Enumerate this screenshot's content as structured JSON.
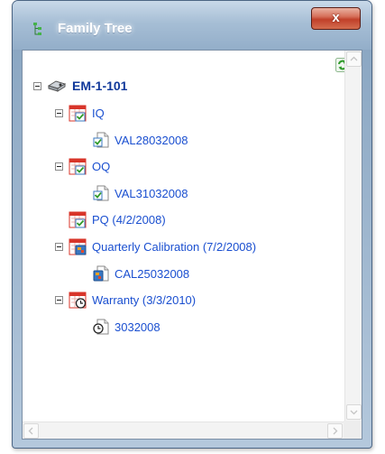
{
  "window": {
    "title": "Family Tree",
    "close_label": "x"
  },
  "tree": {
    "root": {
      "label": "EM-1-101",
      "icon": "equipment-icon"
    },
    "nodes": [
      {
        "label": "IQ",
        "icon": "checklist-calendar-icon",
        "expanded": true
      },
      {
        "label": "VAL28032008",
        "icon": "checked-document-icon"
      },
      {
        "label": "OQ",
        "icon": "checklist-calendar-icon",
        "expanded": true
      },
      {
        "label": "VAL31032008",
        "icon": "checked-document-icon"
      },
      {
        "label": "PQ (4/2/2008)",
        "icon": "checklist-calendar-icon"
      },
      {
        "label": "Quarterly Calibration (7/2/2008)",
        "icon": "calibration-calendar-icon",
        "expanded": true
      },
      {
        "label": "CAL25032008",
        "icon": "calibration-document-icon"
      },
      {
        "label": "Warranty (3/3/2010)",
        "icon": "clock-calendar-icon",
        "expanded": true
      },
      {
        "label": "3032008",
        "icon": "clock-document-icon"
      }
    ]
  },
  "colors": {
    "link": "#1a4fd0",
    "root": "#10389a",
    "calendar_red": "#d8352a",
    "check_green": "#2f9a2a"
  }
}
